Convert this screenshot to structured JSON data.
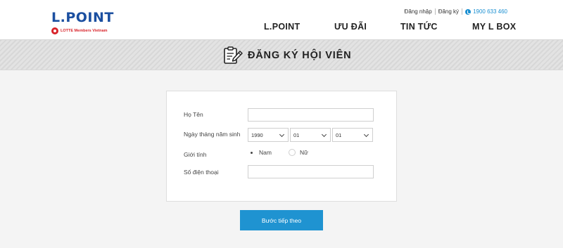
{
  "header": {
    "logo": {
      "text": "L.POINT",
      "subtext": "LOTTE Members Vietnam"
    },
    "utility": {
      "login": "Đăng nhập",
      "register": "Đăng ký",
      "phone": "1900 633 460"
    },
    "nav": [
      "L.POINT",
      "ƯU ĐÃI",
      "TIN TỨC",
      "MY L BOX"
    ]
  },
  "banner": {
    "title": "ĐĂNG KÝ HỘI VIÊN"
  },
  "form": {
    "name_label": "Họ Tên",
    "name_value": "",
    "dob_label": "Ngày tháng năm sinh",
    "dob_year": "1990",
    "dob_month": "01",
    "dob_day": "01",
    "gender_label": "Giới tính",
    "gender_options": [
      {
        "label": "Nam",
        "selected": true
      },
      {
        "label": "Nữ",
        "selected": false
      }
    ],
    "phone_label": "Số điện thoại",
    "phone_value": ""
  },
  "actions": {
    "next_label": "Bước tiếp theo"
  },
  "colors": {
    "brand": "#1b4fa0",
    "accent": "#1f93d1",
    "lotte_red": "#d8232a"
  }
}
